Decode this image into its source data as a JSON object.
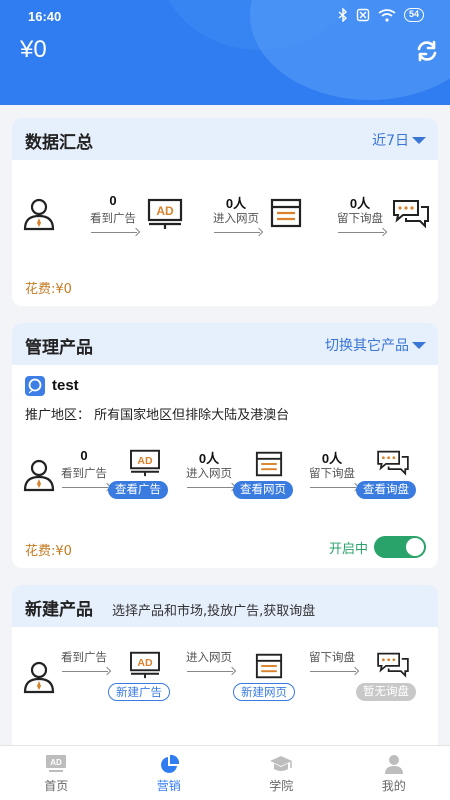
{
  "status": {
    "time": "16:40",
    "battery": "54"
  },
  "header": {
    "balance": "¥0"
  },
  "summary": {
    "title": "数据汇总",
    "range": "近7日",
    "steps": [
      {
        "num": "0",
        "label": "看到广告"
      },
      {
        "num": "0人",
        "label": "进入网页"
      },
      {
        "num": "0人",
        "label": "留下询盘"
      }
    ],
    "cost": "花费:¥0"
  },
  "manage": {
    "title": "管理产品",
    "switch": "切换其它产品",
    "product_name": "test",
    "region": "推广地区：  所有国家地区但排除大陆及港澳台",
    "steps": [
      {
        "num": "0",
        "label": "看到广告"
      },
      {
        "num": "0人",
        "label": "进入网页"
      },
      {
        "num": "0人",
        "label": "留下询盘"
      }
    ],
    "buttons": [
      "查看广告",
      "查看网页",
      "查看询盘"
    ],
    "cost": "花费:¥0",
    "status": "开启中",
    "enabled": true
  },
  "create": {
    "title": "新建产品",
    "subtitle": "选择产品和市场,投放广告,获取询盘",
    "steps": [
      {
        "label": "看到广告"
      },
      {
        "label": "进入网页"
      },
      {
        "label": "留下询盘"
      }
    ],
    "buttons": [
      "新建广告",
      "新建网页",
      "暂无询盘"
    ]
  },
  "tabs": [
    {
      "label": "首页",
      "icon": "ad-board-icon"
    },
    {
      "label": "营销",
      "icon": "pie-chart-icon",
      "active": true
    },
    {
      "label": "学院",
      "icon": "graduation-cap-icon"
    },
    {
      "label": "我的",
      "icon": "user-icon"
    }
  ]
}
